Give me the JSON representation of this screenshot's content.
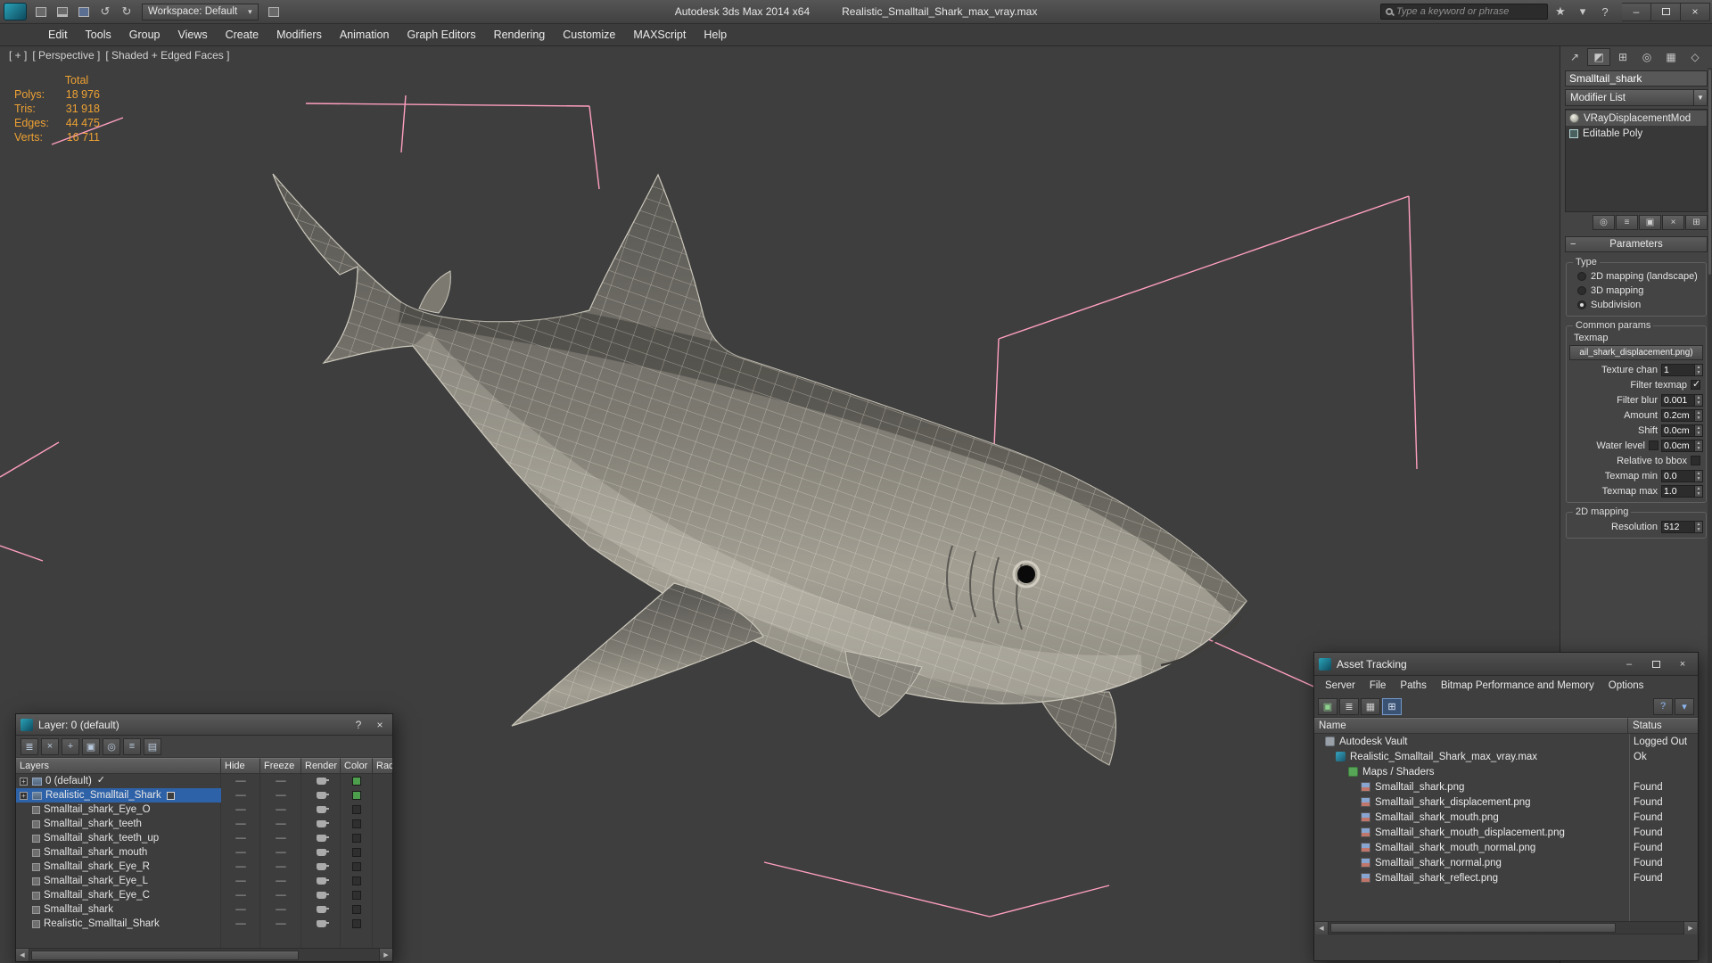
{
  "colors": {
    "accent_pink": "#ff9fc0",
    "cross_red": "#d95f5f",
    "stats_orange": "#eda133",
    "selection_blue": "#2e62a8"
  },
  "icons": {
    "undo": "↺",
    "redo": "↻",
    "dropdown_caret": "▾",
    "star": "★",
    "help": "?",
    "minimize": "–",
    "close": "×",
    "menu_caret": "▾",
    "create_tab": "↗",
    "modify_tab": "◩",
    "hierarchy_tab": "⊞",
    "motion_tab": "◎",
    "display_tab": "▦",
    "utilities_tab": "◇",
    "pin_stack": "◎",
    "show_end_result": "≡",
    "make_unique": "▣",
    "remove_modifier": "×",
    "configure_sets": "⊞",
    "rollout_collapse": "−",
    "spinner_up": "▲",
    "spinner_down": "▼",
    "new_layer": "≣",
    "delete_layer": "×",
    "add_to_layer": "+",
    "select_layer": "▣",
    "highlight_layer": "◎",
    "hide_all": "≡",
    "freeze_all": "▤",
    "toggle_dash": "—",
    "refresh": "▣",
    "report_view": "≣",
    "table_view": "▦",
    "thumbnail_view": "⊞",
    "scroll_left": "◀",
    "scroll_right": "▶"
  },
  "titlebar": {
    "title_left": "Autodesk 3ds Max 2014 x64",
    "title_right": "Realistic_Smalltail_Shark_max_vray.max",
    "workspace_label": "Workspace: Default",
    "search_placeholder": "Type a keyword or phrase"
  },
  "menubar": {
    "items": [
      {
        "label": "Edit"
      },
      {
        "label": "Tools"
      },
      {
        "label": "Group"
      },
      {
        "label": "Views"
      },
      {
        "label": "Create"
      },
      {
        "label": "Modifiers"
      },
      {
        "label": "Animation"
      },
      {
        "label": "Graph Editors"
      },
      {
        "label": "Rendering"
      },
      {
        "label": "Customize"
      },
      {
        "label": "MAXScript"
      },
      {
        "label": "Help"
      }
    ]
  },
  "viewport": {
    "label_parts": [
      {
        "text": "[ + ]"
      },
      {
        "text": "[ Perspective ]"
      },
      {
        "text": "[ Shaded + Edged Faces ]"
      }
    ],
    "stats": {
      "header": "Total",
      "rows": [
        {
          "label": "Polys:",
          "value": "18 976"
        },
        {
          "label": "Tris:",
          "value": "31 918"
        },
        {
          "label": "Edges:",
          "value": "44 475"
        },
        {
          "label": "Verts:",
          "value": "16 711"
        }
      ]
    }
  },
  "command_panel": {
    "object_name": "Smalltail_shark",
    "modifier_list_label": "Modifier List",
    "stack": [
      {
        "label": "VRayDisplacementMod",
        "type": "bulb",
        "selected": true
      },
      {
        "label": "Editable Poly",
        "type": "poly"
      }
    ],
    "rollout_title": "Parameters",
    "type_group": {
      "title": "Type",
      "options": [
        {
          "label": "2D mapping (landscape)",
          "checked": false
        },
        {
          "label": "3D mapping",
          "checked": false
        },
        {
          "label": "Subdivision",
          "checked": true
        }
      ]
    },
    "common_group": {
      "title": "Common params",
      "texmap_label": "Texmap",
      "texmap_button": "ail_shark_displacement.png)",
      "fields": [
        {
          "label": "Texture chan",
          "type": "spinner",
          "value": "1"
        },
        {
          "label": "Filter texmap",
          "type": "checkbox",
          "checked": true
        },
        {
          "label": "Filter blur",
          "type": "spinner",
          "value": "0.001"
        },
        {
          "label": "Amount",
          "type": "spinner",
          "value": "0.2cm"
        },
        {
          "label": "Shift",
          "type": "spinner",
          "value": "0.0cm"
        },
        {
          "label": "Water level",
          "type": "checkspin",
          "checked": false,
          "value": "0.0cm"
        },
        {
          "label": "Relative to bbox",
          "type": "checkbox",
          "checked": false
        },
        {
          "label": "Texmap min",
          "type": "spinner",
          "value": "0.0"
        },
        {
          "label": "Texmap max",
          "type": "spinner",
          "value": "1.0"
        }
      ]
    },
    "mapping_group": {
      "title": "2D mapping",
      "fields": [
        {
          "label": "Resolution",
          "type": "spinner",
          "value": "512"
        }
      ]
    }
  },
  "layer_dialog": {
    "title": "Layer: 0 (default)",
    "help_label": "?",
    "columns": [
      {
        "label": "Layers"
      },
      {
        "label": "Hide"
      },
      {
        "label": "Freeze"
      },
      {
        "label": "Render"
      },
      {
        "label": "Color"
      },
      {
        "label": "Rad"
      }
    ],
    "rows": [
      {
        "name": "0 (default)",
        "type": "layer",
        "current": true,
        "color": "#4d9e4d"
      },
      {
        "name": "Realistic_Smalltail_Shark",
        "type": "layer",
        "selected": true,
        "color": "#4d9e4d"
      },
      {
        "name": "Smalltail_shark_Eye_O",
        "type": "object",
        "color": "#2f2f2f"
      },
      {
        "name": "Smalltail_shark_teeth",
        "type": "object",
        "color": "#2f2f2f"
      },
      {
        "name": "Smalltail_shark_teeth_up",
        "type": "object",
        "color": "#2f2f2f"
      },
      {
        "name": "Smalltail_shark_mouth",
        "type": "object",
        "color": "#2f2f2f"
      },
      {
        "name": "Smalltail_shark_Eye_R",
        "type": "object",
        "color": "#2f2f2f"
      },
      {
        "name": "Smalltail_shark_Eye_L",
        "type": "object",
        "color": "#2f2f2f"
      },
      {
        "name": "Smalltail_shark_Eye_C",
        "type": "object",
        "color": "#2f2f2f"
      },
      {
        "name": "Smalltail_shark",
        "type": "object",
        "color": "#2f2f2f"
      },
      {
        "name": "Realistic_Smalltail_Shark",
        "type": "object",
        "color": "#2f2f2f"
      }
    ]
  },
  "asset_dialog": {
    "title": "Asset Tracking",
    "menus": [
      {
        "label": "Server"
      },
      {
        "label": "File"
      },
      {
        "label": "Paths"
      },
      {
        "label": "Bitmap Performance and Memory"
      },
      {
        "label": "Options"
      }
    ],
    "columns": {
      "name": "Name",
      "status": "Status"
    },
    "rows": [
      {
        "name": "Autodesk Vault",
        "status": "Logged Out",
        "type": "vault",
        "indent": 0
      },
      {
        "name": "Realistic_Smalltail_Shark_max_vray.max",
        "status": "Ok",
        "type": "maxfile",
        "indent": 1
      },
      {
        "name": "Maps / Shaders",
        "status": "",
        "type": "group",
        "indent": 2
      },
      {
        "name": "Smalltail_shark.png",
        "status": "Found",
        "type": "image",
        "indent": 3
      },
      {
        "name": "Smalltail_shark_displacement.png",
        "status": "Found",
        "type": "image",
        "indent": 3
      },
      {
        "name": "Smalltail_shark_mouth.png",
        "status": "Found",
        "type": "image",
        "indent": 3
      },
      {
        "name": "Smalltail_shark_mouth_displacement.png",
        "status": "Found",
        "type": "image",
        "indent": 3
      },
      {
        "name": "Smalltail_shark_mouth_normal.png",
        "status": "Found",
        "type": "image",
        "indent": 3
      },
      {
        "name": "Smalltail_shark_normal.png",
        "status": "Found",
        "type": "image",
        "indent": 3
      },
      {
        "name": "Smalltail_shark_reflect.png",
        "status": "Found",
        "type": "image",
        "indent": 3
      }
    ]
  }
}
